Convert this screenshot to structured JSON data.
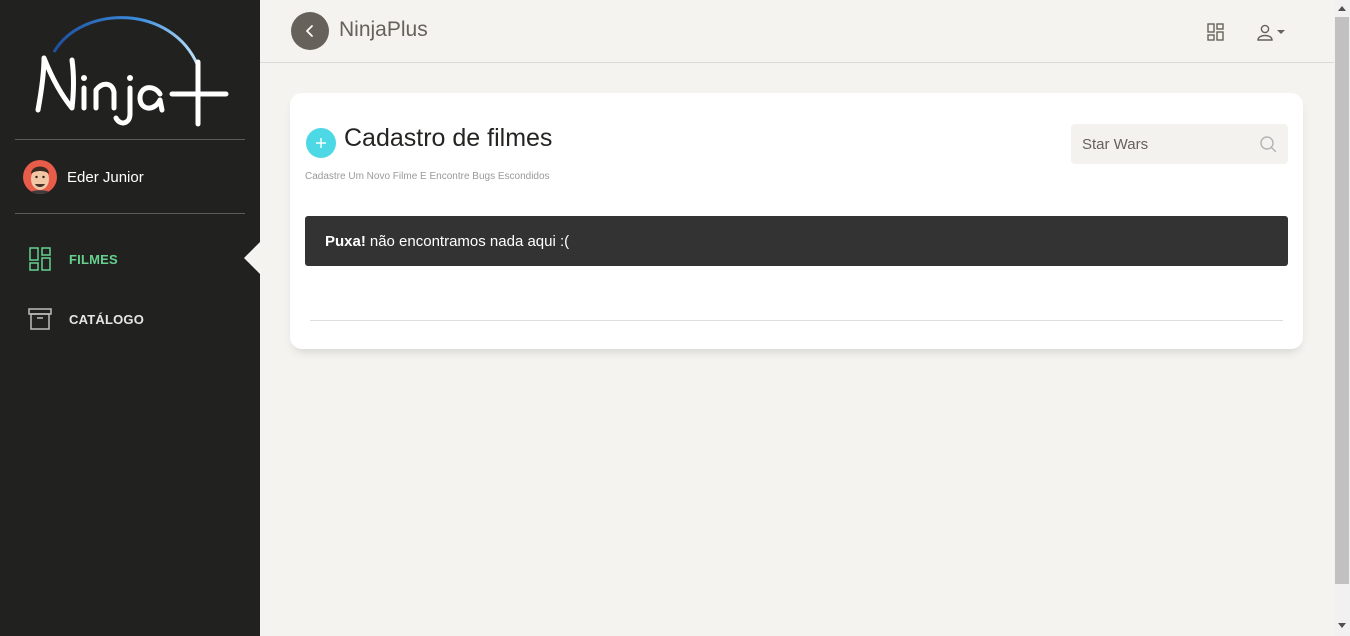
{
  "logo": {
    "text": "Ninja+",
    "accent": "#4aa3e6"
  },
  "user": {
    "name": "Eder Junior"
  },
  "sidebar": {
    "items": [
      {
        "label": "FILMES",
        "icon": "dashboard-icon",
        "active": true,
        "color": "#66d18f"
      },
      {
        "label": "CATÁLOGO",
        "icon": "archive-icon",
        "active": false,
        "color": "#e6e6e6"
      }
    ]
  },
  "topbar": {
    "brand": "NinjaPlus",
    "back_icon": "chevron-left-icon",
    "dashboard_icon": "dashboard-icon",
    "user_icon": "user-icon"
  },
  "page": {
    "title": "Cadastro de filmes",
    "subtitle": "Cadastre Um Novo Filme E Encontre Bugs Escondidos",
    "add_icon": "plus-icon",
    "add_color": "#4dd8e5"
  },
  "search": {
    "value": "Star Wars",
    "icon": "search-icon"
  },
  "alert": {
    "strong": "Puxa!",
    "message": "não encontramos nada aqui :("
  }
}
